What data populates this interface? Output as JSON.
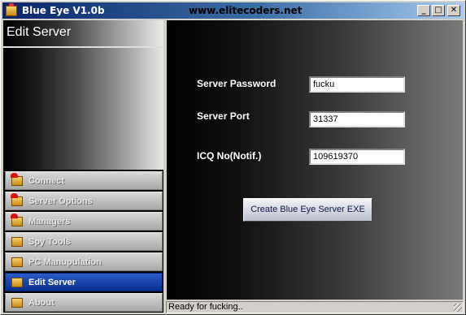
{
  "window": {
    "title": "Blue Eye V1.0b",
    "url": "www.elitecoders.net",
    "minimize": "_",
    "maximize": "□",
    "close": "✕"
  },
  "sidebar": {
    "header": "Edit Server",
    "items": [
      {
        "label": "Connect",
        "icon": "red-folder-icon"
      },
      {
        "label": "Server Options",
        "icon": "red-folder-icon"
      },
      {
        "label": "Managers",
        "icon": "red-folder-icon"
      },
      {
        "label": "Spy Tools",
        "icon": "folder-icon"
      },
      {
        "label": "PC Manupulation",
        "icon": "folder-icon"
      },
      {
        "label": "Edit Server",
        "icon": "folder-icon",
        "active": true
      },
      {
        "label": "About",
        "icon": "folder-icon"
      }
    ]
  },
  "form": {
    "password_label": "Server Password",
    "password_value": "fucku",
    "port_label": "Server Port",
    "port_value": "31337",
    "icq_label": "ICQ No(Notif.)",
    "icq_value": "109619370",
    "create_button": "Create Blue Eye Server EXE"
  },
  "status": {
    "text": "Ready for fucking.."
  },
  "colors": {
    "active_item": "#0a2f8c",
    "titlebar": "#0a246a"
  }
}
